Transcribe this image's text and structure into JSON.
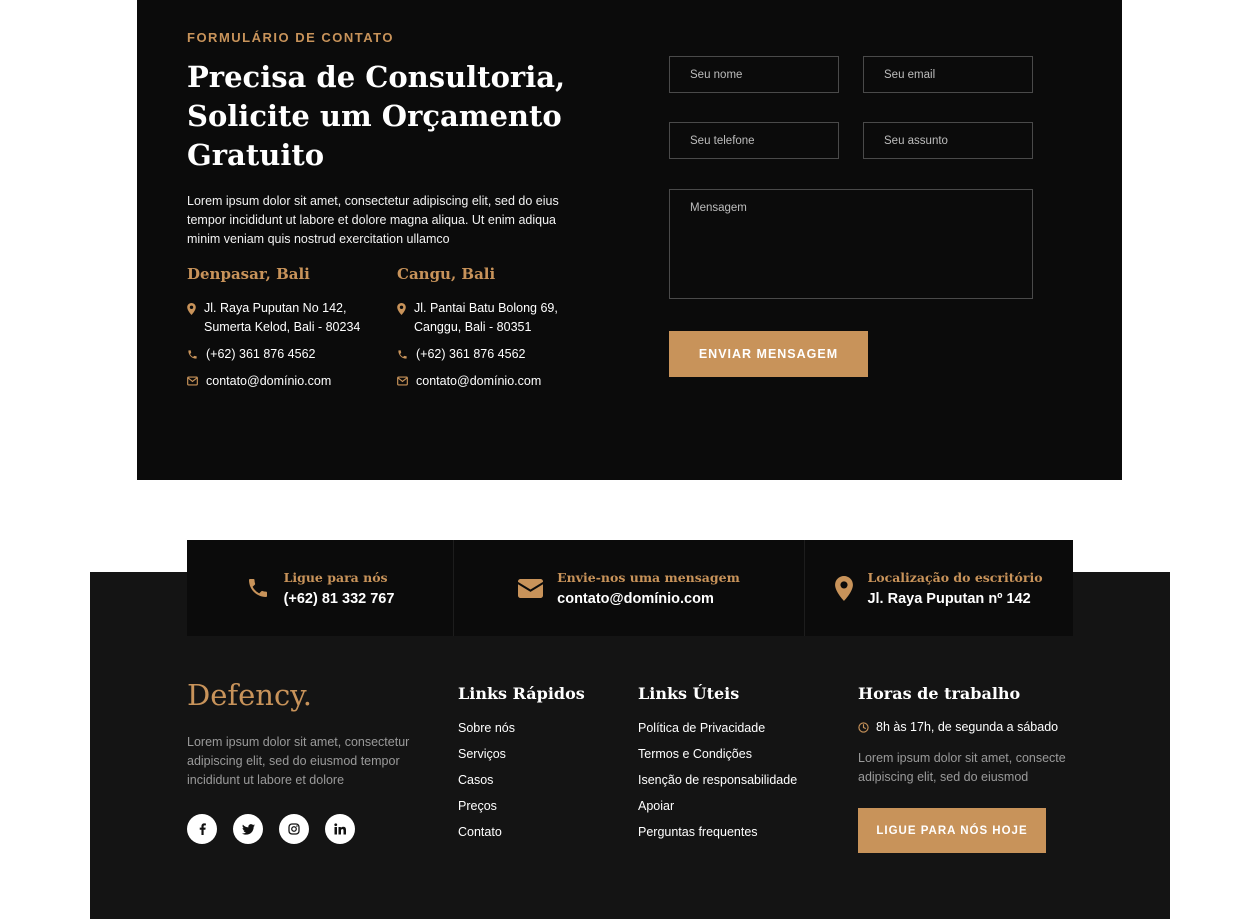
{
  "contact": {
    "eyebrow": "FORMULÁRIO DE CONTATO",
    "heading": "Precisa de Consultoria, Solicite um Orçamento Gratuito",
    "intro": "Lorem ipsum dolor sit amet, consectetur adipiscing elit, sed do eius tempor incididunt ut labore et dolore magna aliqua. Ut enim adiqua minim veniam quis nostrud exercitation ullamco",
    "offices": [
      {
        "title": "Denpasar, Bali",
        "address": "Jl. Raya Puputan No 142, Sumerta Kelod, Bali - 80234",
        "phone": "(+62) 361 876 4562",
        "email": "contato@domínio.com"
      },
      {
        "title": "Cangu, Bali",
        "address": "Jl. Pantai Batu Bolong 69, Canggu, Bali - 80351",
        "phone": "(+62) 361 876 4562",
        "email": "contato@domínio.com"
      }
    ],
    "form": {
      "name_placeholder": "Seu nome",
      "email_placeholder": "Seu email",
      "phone_placeholder": "Seu telefone",
      "subject_placeholder": "Seu assunto",
      "message_placeholder": "Mensagem",
      "submit_label": "ENVIAR MENSAGEM"
    }
  },
  "topbar": [
    {
      "icon": "phone-icon",
      "label": "Ligue para nós",
      "value": "(+62) 81 332 767"
    },
    {
      "icon": "envelope-icon",
      "label": "Envie-nos uma mensagem",
      "value": "contato@domínio.com"
    },
    {
      "icon": "map-pin-icon",
      "label": "Localização do escritório",
      "value": "Jl. Raya Puputan nº 142"
    }
  ],
  "footer": {
    "brand": "Defency.",
    "about": "Lorem ipsum dolor sit amet, consectetur adipiscing elit, sed do eiusmod tempor incididunt ut labore et dolore",
    "social": [
      "facebook-icon",
      "twitter-icon",
      "instagram-icon",
      "linkedin-icon"
    ],
    "quick_links": {
      "title": "Links Rápidos",
      "items": [
        "Sobre nós",
        "Serviços",
        "Casos",
        "Preços",
        "Contato"
      ]
    },
    "useful_links": {
      "title": "Links Úteis",
      "items": [
        "Política de Privacidade",
        "Termos e Condições",
        "Isenção de responsabilidade",
        "Apoiar",
        "Perguntas frequentes"
      ]
    },
    "hours": {
      "title": "Horas de trabalho",
      "time": "8h às 17h, de segunda a sábado",
      "text": "Lorem ipsum dolor sit amet, consecte adipiscing elit, sed do eiusmod",
      "cta_label": "LIGUE PARA NÓS HOJE"
    }
  },
  "colors": {
    "accent": "#c8935a",
    "dark": "#0b0b0b",
    "footer_bg": "#141414"
  }
}
